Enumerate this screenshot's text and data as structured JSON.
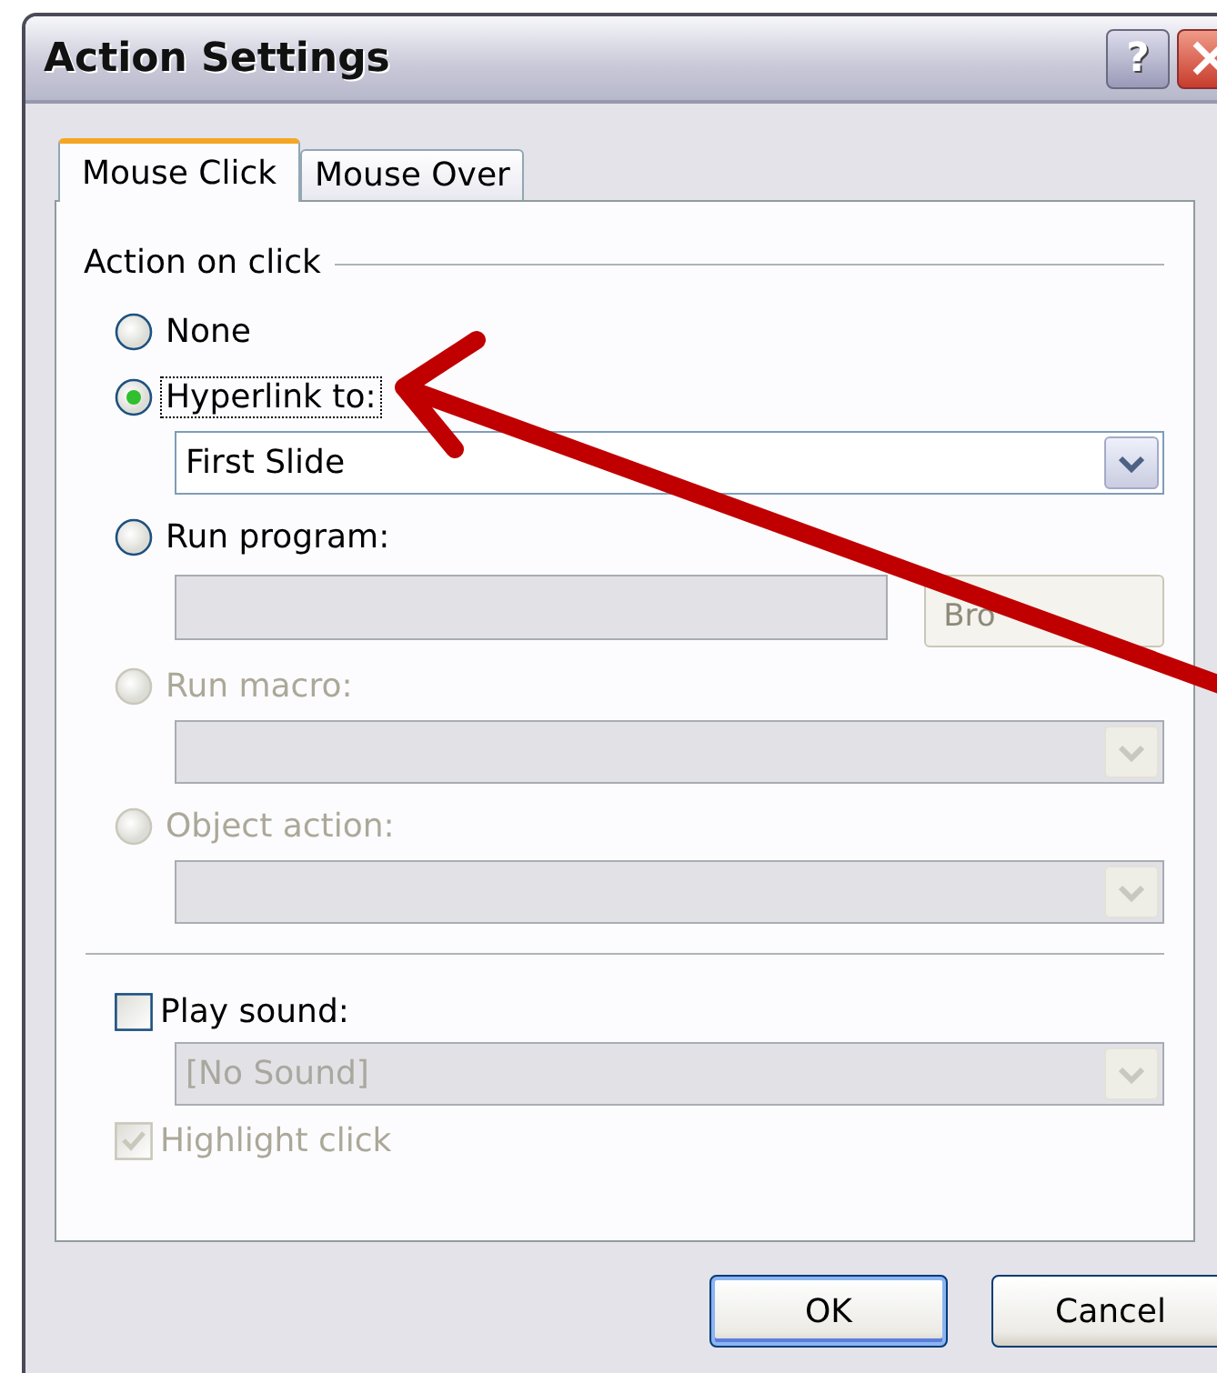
{
  "window": {
    "title": "Action Settings",
    "help_button": "?"
  },
  "tabs": [
    {
      "label": "Mouse Click",
      "selected": true
    },
    {
      "label": "Mouse Over",
      "selected": false
    }
  ],
  "action_group": {
    "title": "Action on click",
    "options": [
      {
        "kind": "radio",
        "label": "None",
        "selected": false,
        "disabled": false
      },
      {
        "kind": "radio",
        "label": "Hyperlink to:",
        "selected": true,
        "disabled": false,
        "focused": true,
        "dropdown": {
          "value": "First Slide",
          "disabled": false
        }
      },
      {
        "kind": "radio",
        "label": "Run program:",
        "selected": false,
        "disabled": false,
        "field": {
          "disabled": true
        },
        "button": {
          "label": "Bro",
          "disabled": true
        }
      },
      {
        "kind": "radio",
        "label": "Run macro:",
        "selected": false,
        "disabled": true,
        "dropdown": {
          "disabled": true
        }
      },
      {
        "kind": "radio",
        "label": "Object action:",
        "selected": false,
        "disabled": true,
        "dropdown": {
          "disabled": true
        }
      }
    ]
  },
  "play_sound": {
    "label": "Play sound:",
    "checked": false,
    "disabled": false
  },
  "sound_dropdown": {
    "value": "[No Sound]",
    "disabled": true
  },
  "highlight_click": {
    "label": "Highlight click",
    "checked": true,
    "disabled": true
  },
  "buttons": [
    {
      "label": "OK",
      "default": true
    },
    {
      "label": "Cancel",
      "default": false
    }
  ]
}
